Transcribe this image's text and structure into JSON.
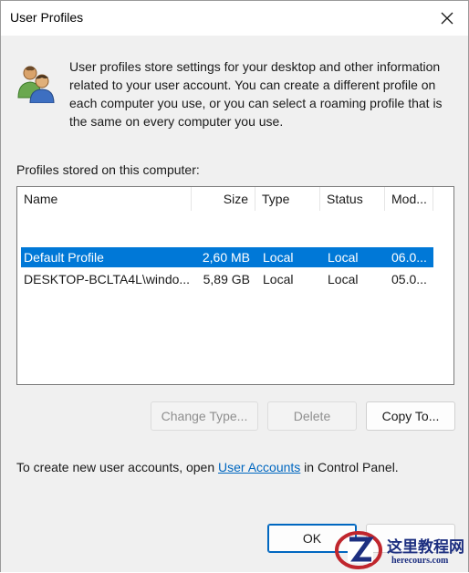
{
  "window": {
    "title": "User Profiles"
  },
  "intro": {
    "text": "User profiles store settings for your desktop and other information related to your user account. You can create a different profile on each computer you use, or you can select a roaming profile that is the same on every computer you use.",
    "icon": "users-icon"
  },
  "profiles": {
    "label": "Profiles stored on this computer:",
    "columns": {
      "name": "Name",
      "size": "Size",
      "type": "Type",
      "status": "Status",
      "modified": "Mod..."
    },
    "rows": [
      {
        "name": "Default Profile",
        "size": "2,60 MB",
        "type": "Local",
        "status": "Local",
        "modified": "06.0...",
        "selected": true
      },
      {
        "name": "DESKTOP-BCLTA4L\\windo...",
        "size": "5,89 GB",
        "type": "Local",
        "status": "Local",
        "modified": "05.0...",
        "selected": false
      }
    ]
  },
  "buttons": {
    "change_type": "Change Type...",
    "delete": "Delete",
    "copy_to": "Copy To...",
    "ok": "OK"
  },
  "footer": {
    "prefix": "To create new user accounts, open ",
    "link": "User Accounts",
    "suffix": " in Control Panel."
  },
  "watermark": {
    "cn": "这里教程网",
    "en": "herecours.com"
  },
  "colors": {
    "selection": "#0078d7",
    "link": "#0067c0",
    "dialog_bg": "#f0f0f0"
  }
}
